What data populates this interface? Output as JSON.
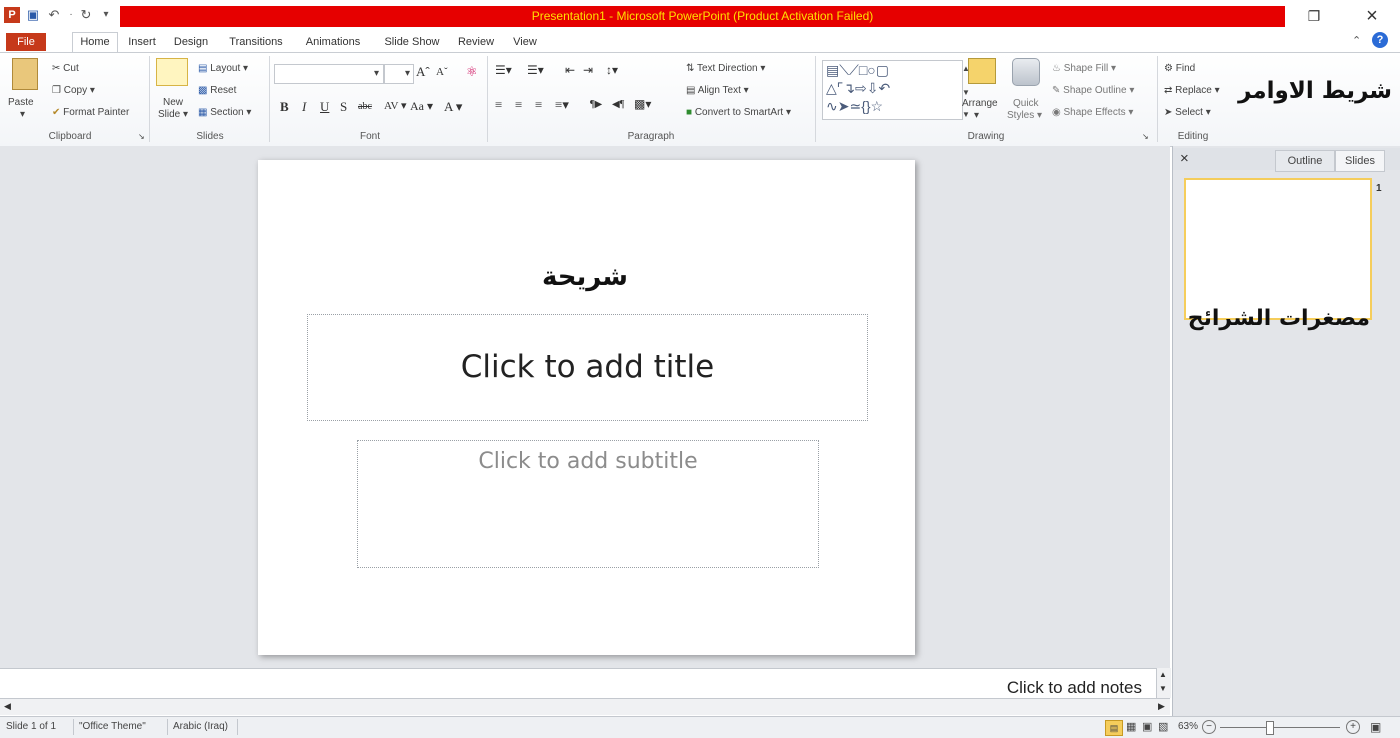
{
  "window": {
    "title": "Presentation1 - Microsoft PowerPoint (Product Activation Failed)",
    "title_bg": "#e60000",
    "title_fg": "#ffe000"
  },
  "quick_access": {
    "icons": [
      "powerpoint-icon",
      "save-icon",
      "undo-icon",
      "redo-icon",
      "customize-icon"
    ]
  },
  "tabs": [
    "File",
    "Home",
    "Insert",
    "Design",
    "Transitions",
    "Animations",
    "Slide Show",
    "Review",
    "View"
  ],
  "ribbon": {
    "clipboard": {
      "label": "Clipboard",
      "paste": "Paste",
      "cut": "Cut",
      "copy": "Copy",
      "format_painter": "Format Painter"
    },
    "slides": {
      "label": "Slides",
      "new_slide": "New",
      "new_slide2": "Slide",
      "layout": "Layout",
      "reset": "Reset",
      "section": "Section"
    },
    "font": {
      "label": "Font"
    },
    "paragraph": {
      "label": "Paragraph",
      "text_direction": "Text Direction",
      "align_text": "Align Text",
      "convert": "Convert to SmartArt"
    },
    "drawing": {
      "label": "Drawing",
      "arrange": "Arrange",
      "quick": "Quick",
      "styles": "Styles",
      "shape_fill": "Shape Fill",
      "shape_outline": "Shape Outline",
      "shape_effects": "Shape Effects"
    },
    "editing": {
      "label": "Editing",
      "find": "Find",
      "replace": "Replace",
      "select": "Select"
    }
  },
  "annotations": {
    "ribbon": "شريط الاوامر",
    "slide": "شريحة",
    "thumbnails": "مصغرات الشرائح"
  },
  "slide": {
    "title_placeholder": "Click to add title",
    "subtitle_placeholder": "Click to add subtitle"
  },
  "pane": {
    "outline": "Outline",
    "slides": "Slides",
    "thumb_number": "1"
  },
  "notes": {
    "placeholder": "Click to add notes"
  },
  "status": {
    "slide_of": "Slide 1 of 1",
    "theme": "\"Office Theme\"",
    "language": "Arabic (Iraq)",
    "zoom": "63%"
  }
}
